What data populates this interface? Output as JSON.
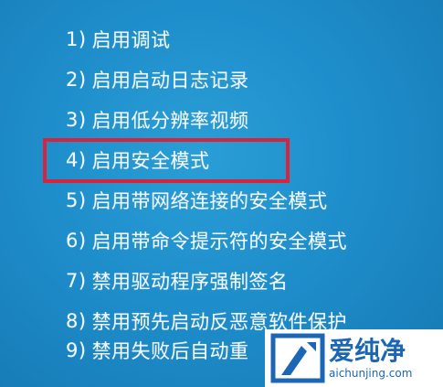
{
  "startup_settings": {
    "options": [
      {
        "number": "1)",
        "label": "启用调试"
      },
      {
        "number": "2)",
        "label": "启用启动日志记录"
      },
      {
        "number": "3)",
        "label": "启用低分辨率视频"
      },
      {
        "number": "4)",
        "label": "启用安全模式"
      },
      {
        "number": "5)",
        "label": "启用带网络连接的安全模式"
      },
      {
        "number": "6)",
        "label": "启用带命令提示符的安全模式"
      },
      {
        "number": "7)",
        "label": "禁用驱动程序强制签名"
      },
      {
        "number": "8)",
        "label": "禁用预先启动反恶意软件保护"
      },
      {
        "number": "9)",
        "label": "禁用失败后自动重"
      }
    ],
    "highlighted_option": "4)"
  },
  "watermark": {
    "name": "爱纯净",
    "url": "aichunjing.com"
  },
  "colors": {
    "background": "#1e8ecb",
    "text": "#f4f8fb",
    "highlight_border": "#d8233c",
    "watermark_blue": "#1b67b6"
  }
}
